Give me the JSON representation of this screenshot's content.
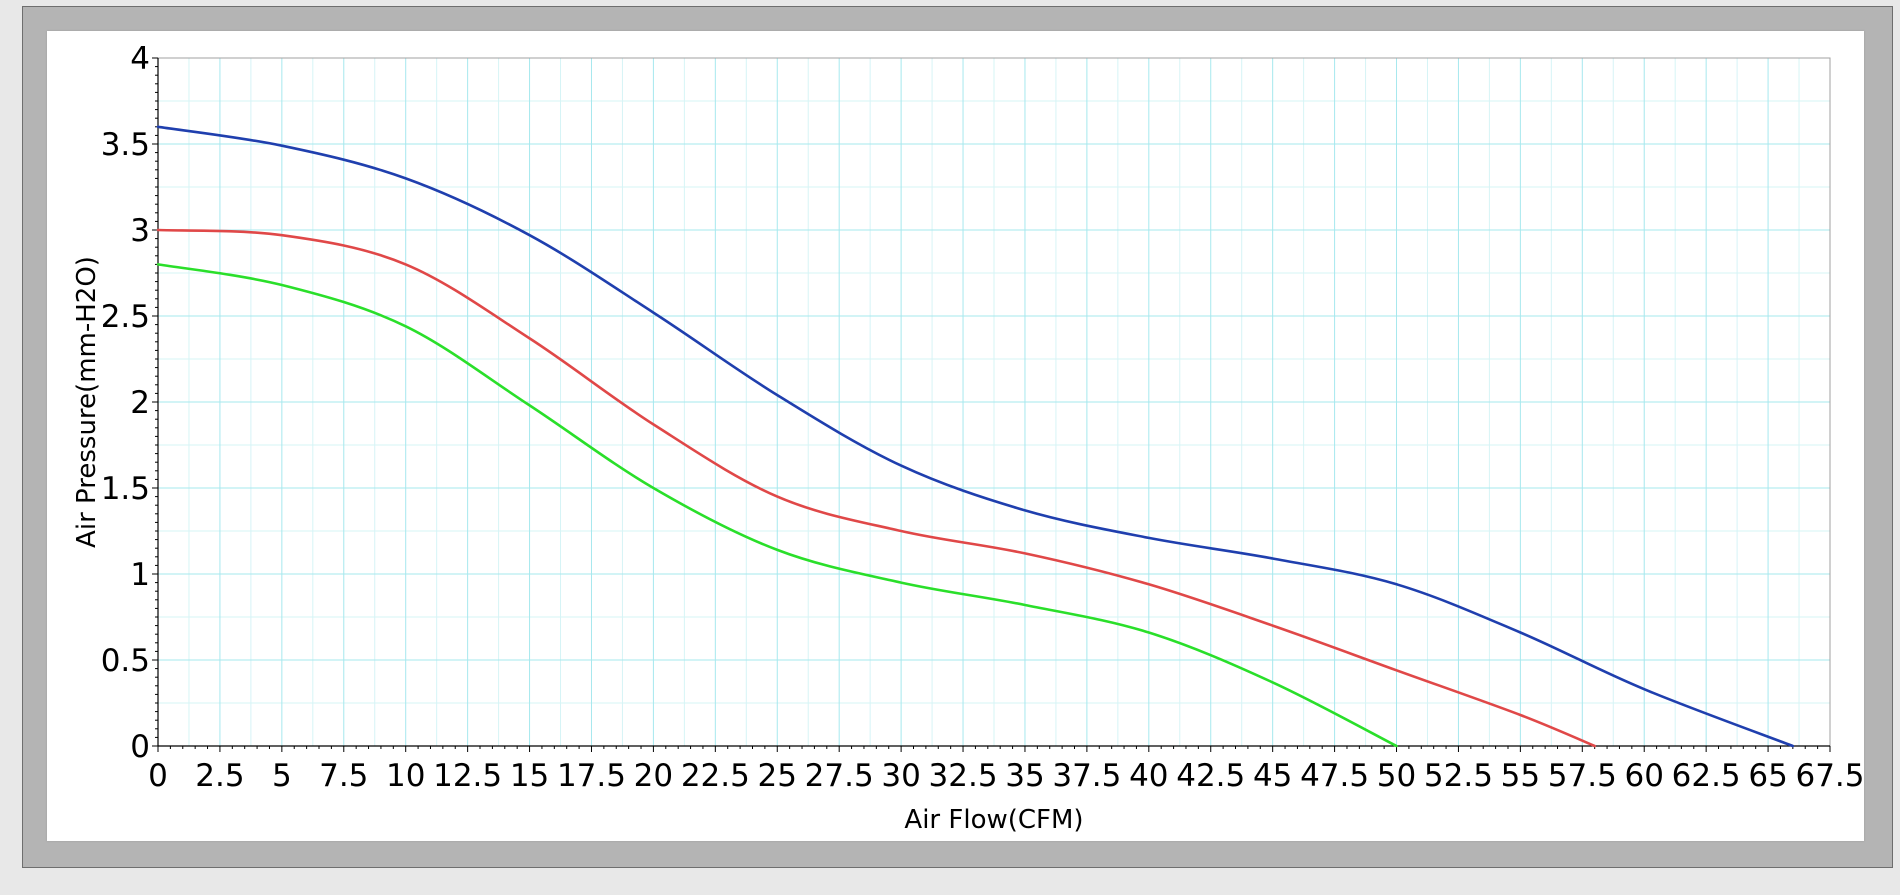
{
  "chart_data": {
    "type": "line",
    "xlabel": "Air Flow(CFM)",
    "ylabel": "Air Pressure(mm-H2O)",
    "xlim": [
      0,
      67.5
    ],
    "ylim": [
      0,
      4
    ],
    "x_ticks": [
      "0",
      "2.5",
      "5",
      "7.5",
      "10",
      "12.5",
      "15",
      "17.5",
      "20",
      "22.5",
      "25",
      "27.5",
      "30",
      "32.5",
      "35",
      "37.5",
      "40",
      "42.5",
      "45",
      "47.5",
      "50",
      "52.5",
      "55",
      "57.5",
      "60",
      "62.5",
      "65",
      "67.5"
    ],
    "y_ticks": [
      "0",
      "0.5",
      "1",
      "1.5",
      "2",
      "2.5",
      "3",
      "3.5",
      "4"
    ],
    "grid": true,
    "series": [
      {
        "color": "#1f3fae",
        "x": [
          0,
          5,
          10,
          15,
          20,
          25,
          30,
          35,
          40,
          45,
          50,
          55,
          60,
          66
        ],
        "y": [
          3.6,
          3.49,
          3.3,
          2.97,
          2.52,
          2.04,
          1.63,
          1.37,
          1.21,
          1.09,
          0.94,
          0.66,
          0.33,
          0
        ]
      },
      {
        "color": "#e04848",
        "x": [
          0,
          5,
          10,
          15,
          20,
          25,
          30,
          35,
          40,
          45,
          50,
          55,
          58
        ],
        "y": [
          3.0,
          2.97,
          2.8,
          2.37,
          1.87,
          1.45,
          1.25,
          1.12,
          0.94,
          0.7,
          0.44,
          0.18,
          0
        ]
      },
      {
        "color": "#2adf2a",
        "x": [
          0,
          5,
          10,
          15,
          20,
          25,
          30,
          35,
          40,
          45,
          50
        ],
        "y": [
          2.8,
          2.68,
          2.44,
          1.98,
          1.5,
          1.14,
          0.95,
          0.82,
          0.66,
          0.37,
          0
        ]
      }
    ]
  }
}
